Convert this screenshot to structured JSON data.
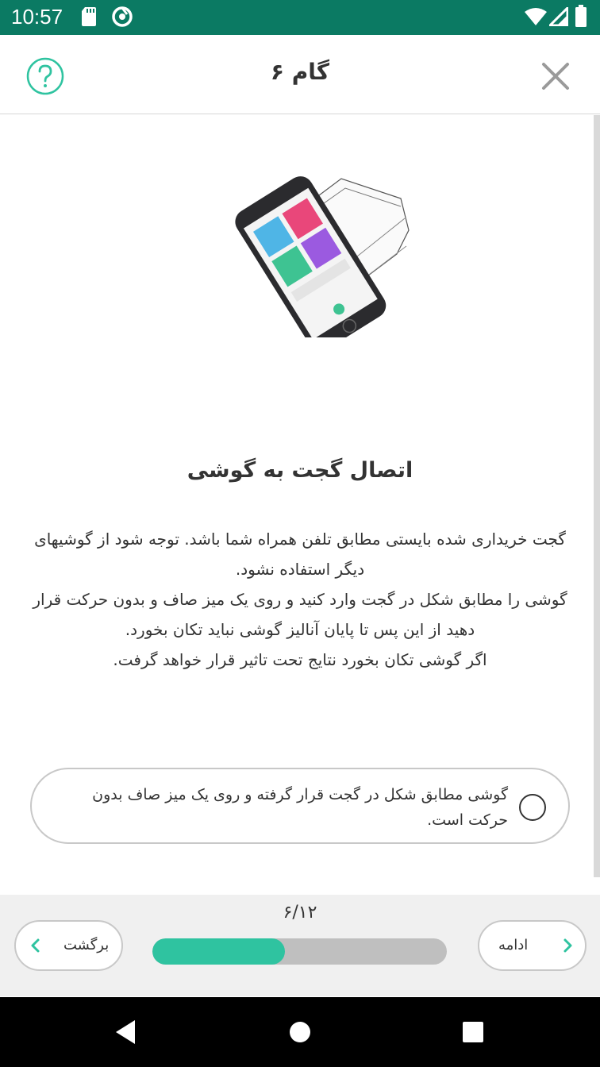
{
  "status_bar": {
    "time": "10:57",
    "left_icons": [
      "sd-card-icon",
      "data-saver-icon"
    ],
    "right_icons": [
      "wifi-icon",
      "signal-icon",
      "battery-icon"
    ]
  },
  "app_bar": {
    "title": "گام ۶",
    "help_icon": "question-circle-icon",
    "close_icon": "close-icon",
    "accent_color": "#2fc3a0"
  },
  "main": {
    "illustration": "phone-in-gadget-image",
    "heading": "اتصال گجت به گوشی",
    "description": [
      "گجت خریداری شده بایستی مطابق تلفن همراه شما باشد. توجه شود از گوشیهای دیگر استفاده نشود.",
      "گوشی را مطابق شکل در گجت وارد کنید و روی یک میز صاف و بدون حرکت قرار دهید از این پس تا پایان آنالیز گوشی نباید تکان بخورد.",
      "اگر گوشی تکان بخورد نتایج تحت تاثیر قرار خواهد گرفت."
    ],
    "confirm_option": {
      "label": "گوشی مطابق شکل در گجت قرار گرفته و روی یک میز صاف بدون حرکت است.",
      "checked": false
    }
  },
  "footer": {
    "step_counter": "۶/۱۲",
    "progress_fraction": 0.45,
    "progress_color": "#2fc3a0",
    "back_label": "برگشت",
    "next_label": "ادامه"
  },
  "nav_bar": {
    "items": [
      "back-triangle-icon",
      "home-circle-icon",
      "recents-square-icon"
    ]
  }
}
